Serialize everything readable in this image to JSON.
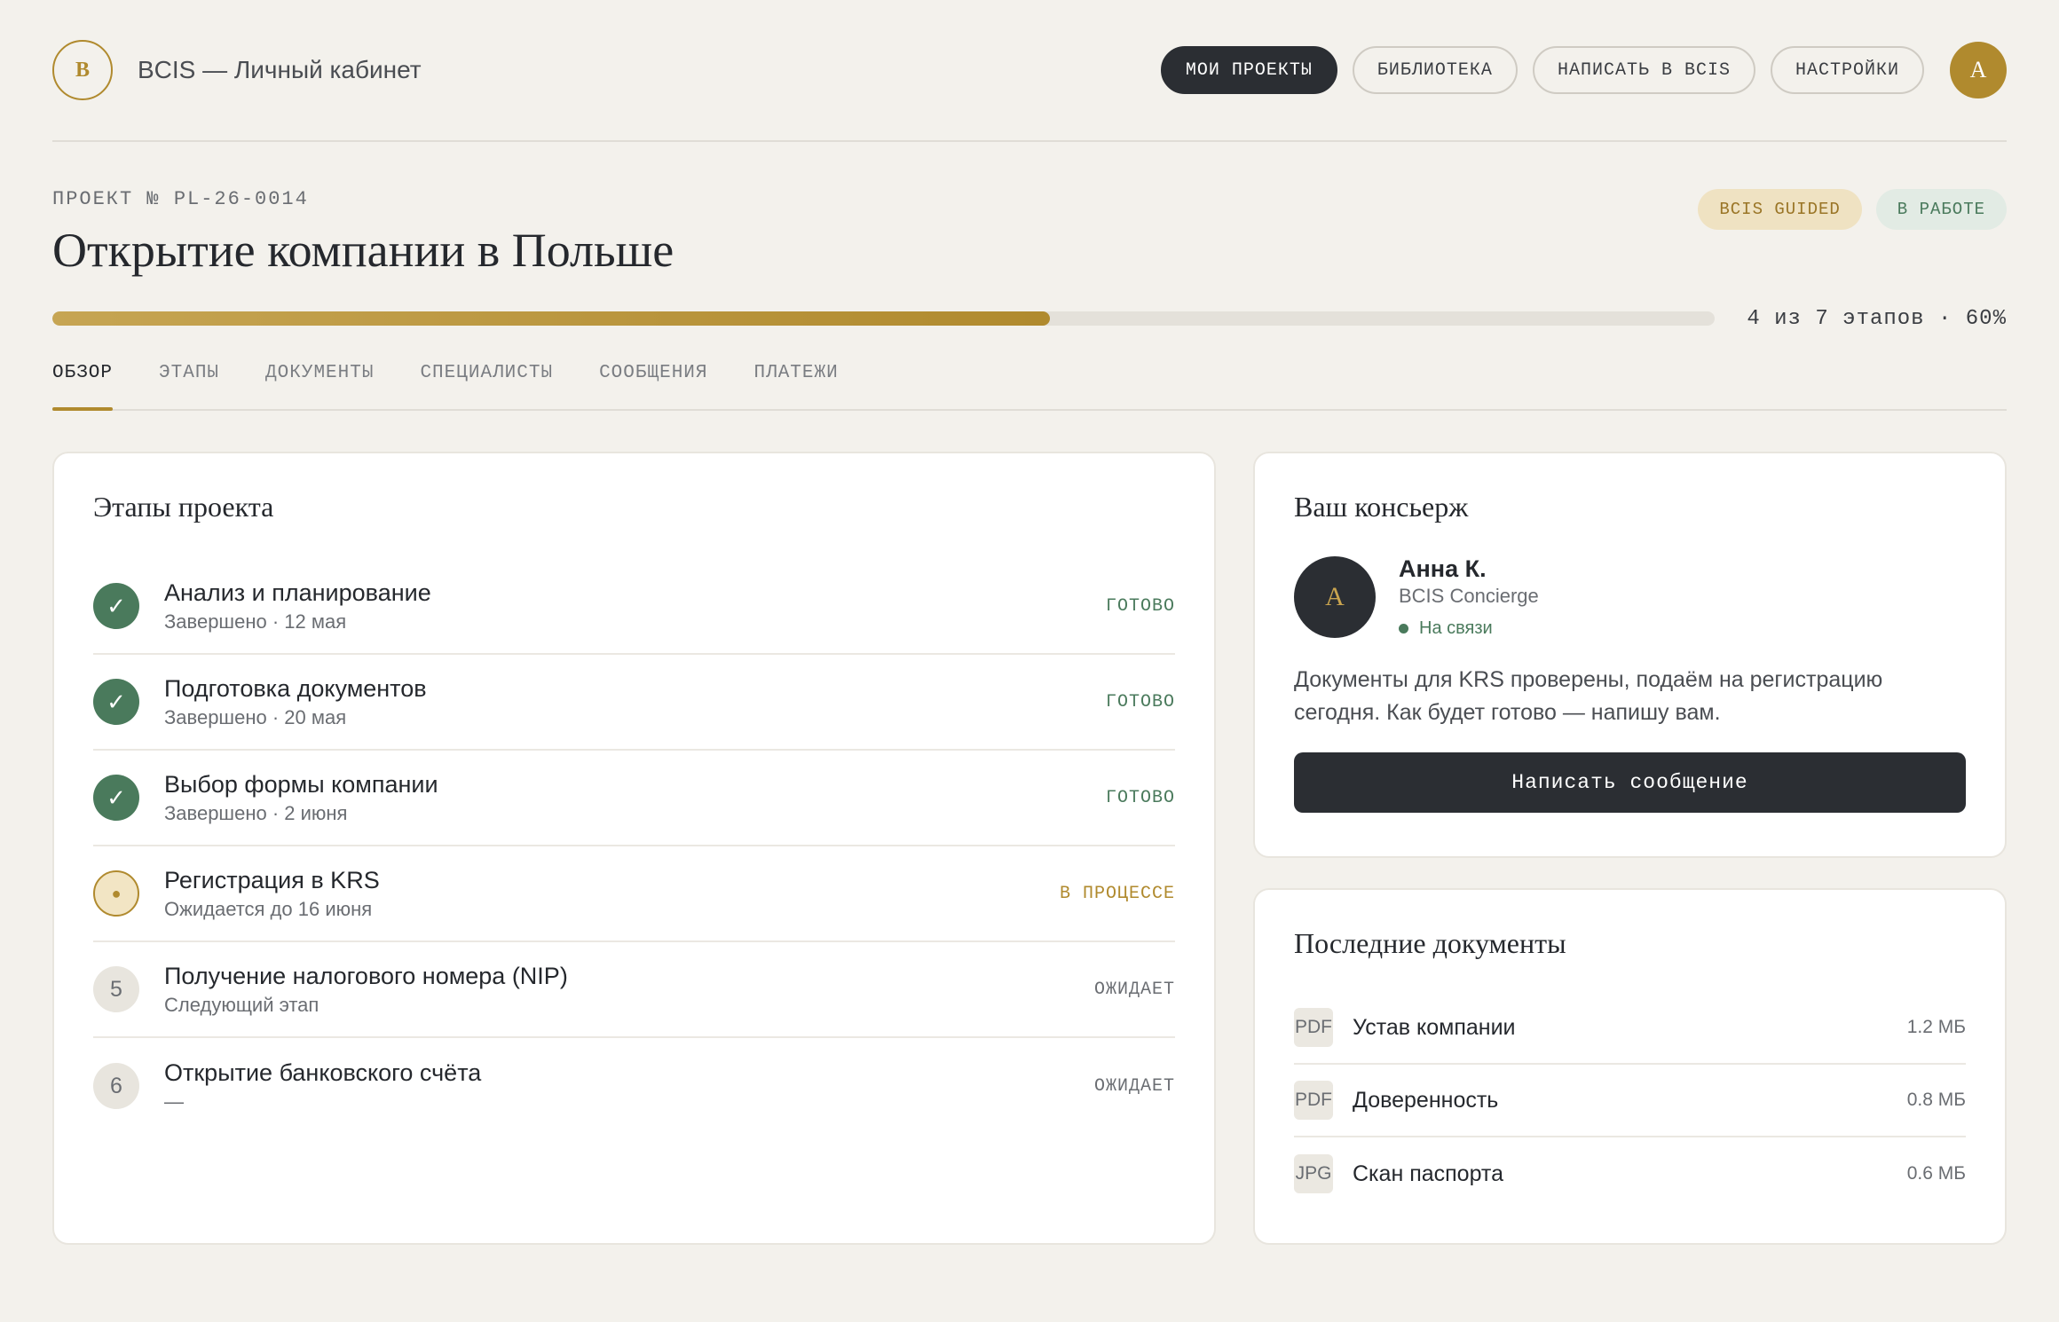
{
  "header": {
    "logo_letter": "B",
    "app_title": "BCIS — Личный кабинет",
    "nav": [
      "МОИ ПРОЕКТЫ",
      "БИБЛИОТЕКА",
      "НАПИСАТЬ В BCIS",
      "НАСТРОЙКИ"
    ],
    "active_nav": "МОИ ПРОЕКТЫ",
    "avatar_letter": "A"
  },
  "project": {
    "code": "ПРОЕКТ № PL-26-0014",
    "title": "Открытие компании в Польше",
    "badges": {
      "guided": "BCIS GUIDED",
      "status": "В РАБОТЕ"
    },
    "progress_fraction": 0.6,
    "progress_text": "4 из 7 этапов · 60%"
  },
  "tabs": [
    "ОБЗОР",
    "ЭТАПЫ",
    "ДОКУМЕНТЫ",
    "СПЕЦИАЛИСТЫ",
    "СООБЩЕНИЯ",
    "ПЛАТЕЖИ"
  ],
  "active_tab": "ОБЗОР",
  "stages": {
    "title": "Этапы проекта",
    "items": [
      {
        "icon": "✓",
        "state": "done",
        "name": "Анализ и планирование",
        "sub": "Завершено · 12 мая",
        "status": "ГОТОВО"
      },
      {
        "icon": "✓",
        "state": "done",
        "name": "Подготовка документов",
        "sub": "Завершено · 20 мая",
        "status": "ГОТОВО"
      },
      {
        "icon": "✓",
        "state": "done",
        "name": "Выбор формы компании",
        "sub": "Завершено · 2 июня",
        "status": "ГОТОВО"
      },
      {
        "icon": "●",
        "state": "progress",
        "name": "Регистрация в KRS",
        "sub": "Ожидается до 16 июня",
        "status": "В ПРОЦЕССЕ"
      },
      {
        "icon": "5",
        "state": "wait",
        "name": "Получение налогового номера (NIP)",
        "sub": "Следующий этап",
        "status": "ОЖИДАЕТ"
      },
      {
        "icon": "6",
        "state": "wait",
        "name": "Открытие банковского счёта",
        "sub": "—",
        "status": "ОЖИДАЕТ"
      }
    ]
  },
  "concierge": {
    "title": "Ваш консьерж",
    "avatar_letter": "А",
    "name": "Анна К.",
    "role": "BCIS Concierge",
    "online": "На связи",
    "message": "Документы для KRS проверены, подаём на регистрацию сегодня. Как будет готово — напишу вам.",
    "button": "Написать сообщение"
  },
  "documents": {
    "title": "Последние документы",
    "items": [
      {
        "type": "PDF",
        "name": "Устав компании",
        "size": "1.2 МБ"
      },
      {
        "type": "PDF",
        "name": "Доверенность",
        "size": "0.8 МБ"
      },
      {
        "type": "JPG",
        "name": "Скан паспорта",
        "size": "0.6 МБ"
      }
    ]
  },
  "colors": {
    "accent": "#b08a2e",
    "dark": "#2b2e33",
    "success": "#4a7a5c",
    "background": "#f3f1ec"
  }
}
